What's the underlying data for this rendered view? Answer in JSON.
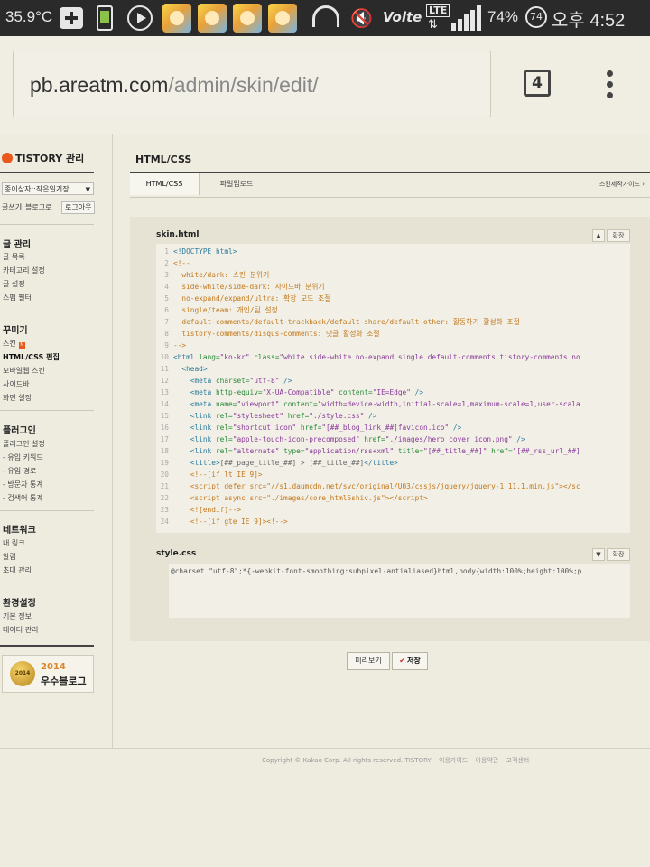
{
  "status_bar": {
    "temperature": "35.9°C",
    "network": "LTE",
    "volte": "Volte",
    "battery": "74%",
    "notification_count": "74",
    "time": "오후 4:52",
    "icons": [
      "add-icon",
      "phone-icon",
      "play-icon",
      "app-icon",
      "app-icon",
      "app-icon",
      "app-icon",
      "headset-icon",
      "mute-icon",
      "signal-icon"
    ]
  },
  "browser": {
    "url_host": "pb.areatm.com",
    "url_path": "/admin/skin/edit/",
    "tab_count": "4",
    "menu_icon": "more-vert-icon"
  },
  "sidebar": {
    "brand": "TISTORY 관리",
    "blog_select": "종이상자::작은일기장...",
    "write": "글쓰기",
    "divider": "|",
    "blog_link": "블로그로",
    "logout": "로그아웃",
    "sections": [
      {
        "title": "글 관리",
        "items": [
          "글 목록",
          "카테고리 설정",
          "글 설정",
          "스팸 필터"
        ]
      },
      {
        "title": "꾸미기",
        "items": [
          "스킨",
          "HTML/CSS 편집",
          "모바일웹 스킨",
          "사이드바",
          "화면 설정"
        ]
      },
      {
        "title": "플러그인",
        "items": [
          "플러그인 설정",
          "- 유입 키워드",
          "- 유입 경로",
          "- 방문자 통계",
          "- 검색어 통계"
        ]
      },
      {
        "title": "네트워크",
        "items": [
          "내 링크",
          "알림",
          "초대 관리"
        ]
      },
      {
        "title": "환경설정",
        "items": [
          "기본 정보",
          "데이터 관리"
        ]
      }
    ],
    "new_badge": "N",
    "award": {
      "medal_text": "2014",
      "year": "2014",
      "text": "우수블로그"
    }
  },
  "main": {
    "title": "HTML/CSS",
    "tabs": [
      "HTML/CSS",
      "파일업로드"
    ],
    "guide_link": "스킨제작가이드 ›",
    "html_file": {
      "name": "skin.html",
      "collapse": "▲",
      "expand": "확장"
    },
    "css_file": {
      "name": "style.css",
      "collapse": "▼",
      "expand": "확장"
    },
    "css_code": "@charset \"utf-8\";*{-webkit-font-smoothing:subpixel-antialiased}html,body{width:100%;height:100%;p",
    "preview_button": "미리보기",
    "save_button": "저장",
    "save_icon": "check-icon"
  },
  "footer": {
    "copyright": "Copyright © Kakao Corp. All rights reserved. TISTORY",
    "links": [
      "이용가이드",
      "이용약관",
      "고객센터"
    ]
  }
}
